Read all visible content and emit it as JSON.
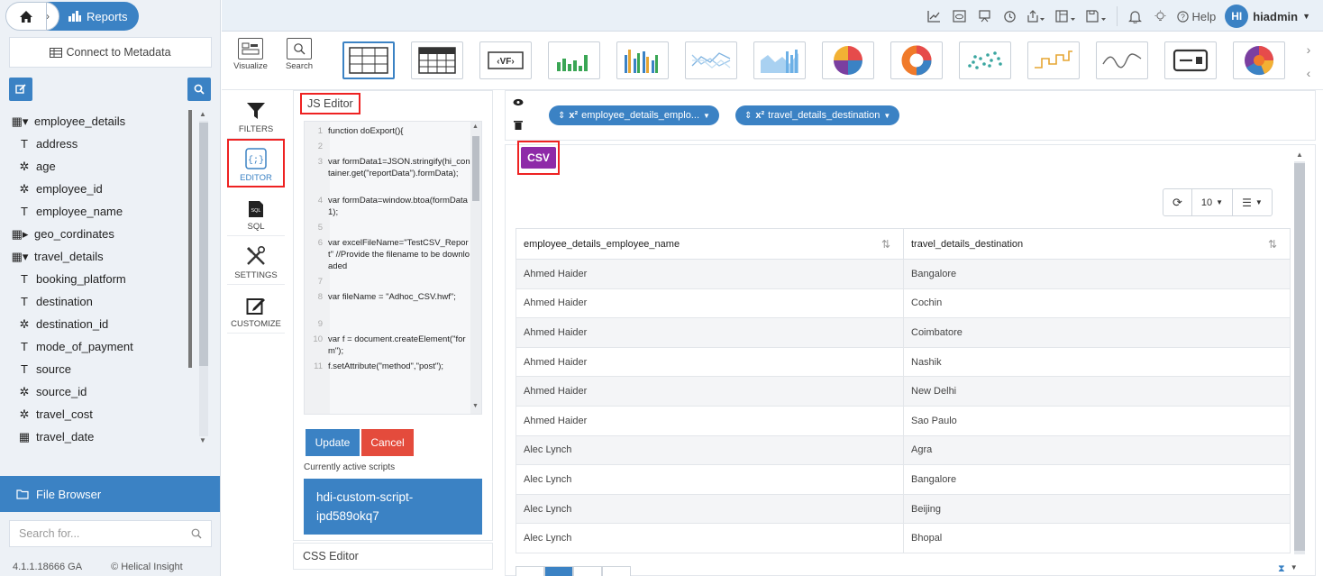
{
  "breadcrumb": {
    "section": "Reports"
  },
  "sidebar": {
    "connect_label": "Connect to Metadata",
    "tree": [
      {
        "icon": "table-icon",
        "glyph": "▦▾",
        "label": "employee_details",
        "level": 0
      },
      {
        "icon": "text-type-icon",
        "glyph": "T",
        "label": "address",
        "level": 1
      },
      {
        "icon": "numeric-type-icon",
        "glyph": "✲",
        "label": "age",
        "level": 1
      },
      {
        "icon": "numeric-type-icon",
        "glyph": "✲",
        "label": "employee_id",
        "level": 1
      },
      {
        "icon": "text-type-icon",
        "glyph": "T",
        "label": "employee_name",
        "level": 1
      },
      {
        "icon": "table-icon",
        "glyph": "▦▸",
        "label": "geo_cordinates",
        "level": 0
      },
      {
        "icon": "table-icon",
        "glyph": "▦▾",
        "label": "travel_details",
        "level": 0
      },
      {
        "icon": "text-type-icon",
        "glyph": "T",
        "label": "booking_platform",
        "level": 1
      },
      {
        "icon": "text-type-icon",
        "glyph": "T",
        "label": "destination",
        "level": 1
      },
      {
        "icon": "numeric-type-icon",
        "glyph": "✲",
        "label": "destination_id",
        "level": 1
      },
      {
        "icon": "text-type-icon",
        "glyph": "T",
        "label": "mode_of_payment",
        "level": 1
      },
      {
        "icon": "text-type-icon",
        "glyph": "T",
        "label": "source",
        "level": 1
      },
      {
        "icon": "numeric-type-icon",
        "glyph": "✲",
        "label": "source_id",
        "level": 1
      },
      {
        "icon": "numeric-type-icon",
        "glyph": "✲",
        "label": "travel_cost",
        "level": 1
      },
      {
        "icon": "date-type-icon",
        "glyph": "▦",
        "label": "travel_date",
        "level": 1
      }
    ],
    "file_browser": "File Browser",
    "search_placeholder": "Search for...",
    "version": "4.1.1.18666 GA",
    "copyright": "© Helical Insight"
  },
  "header": {
    "help_label": "Help",
    "user_initials": "HI",
    "user_name": "hiadmin"
  },
  "viz_toolbar": {
    "visualize_label": "Visualize",
    "search_label": "Search"
  },
  "tools": [
    {
      "name": "filters",
      "label": "FILTERS",
      "icon": "funnel-icon"
    },
    {
      "name": "editor",
      "label": "EDITOR",
      "icon": "code-braces-icon"
    },
    {
      "name": "sql",
      "label": "SQL",
      "icon": "sql-file-icon"
    },
    {
      "name": "settings",
      "label": "SETTINGS",
      "icon": "tools-icon"
    },
    {
      "name": "customize",
      "label": "CUSTOMIZE",
      "icon": "edit-box-icon"
    }
  ],
  "editor": {
    "title": "JS Editor",
    "lines": [
      {
        "n": "1",
        "t": "function doExport(){"
      },
      {
        "n": "2",
        "t": ""
      },
      {
        "n": "3",
        "t": "var formData1=JSON.stringify(hi_container.get(\"reportData\").formData);"
      },
      {
        "n": "4",
        "t": "var formData=window.btoa(formData1);"
      },
      {
        "n": "5",
        "t": ""
      },
      {
        "n": "6",
        "t": "var excelFileName=\"TestCSV_Report\" //Provide the filename to be downloaded"
      },
      {
        "n": "7",
        "t": ""
      },
      {
        "n": "8",
        "t": "var fileName = \"Adhoc_CSV.hwf\";"
      },
      {
        "n": "9",
        "t": ""
      },
      {
        "n": "10",
        "t": "var f = document.createElement(\"form\");"
      },
      {
        "n": "11",
        "t": "f.setAttribute(\"method\",\"post\");"
      }
    ],
    "update_label": "Update",
    "cancel_label": "Cancel",
    "active_scripts_label": "Currently active scripts",
    "active_script": "hdi-custom-script-ipd589okq7",
    "css_editor_label": "CSS Editor"
  },
  "dimensions": [
    {
      "label": "employee_details_emplo..."
    },
    {
      "label": "travel_details_destination"
    }
  ],
  "csv_label": "CSV",
  "table_tools": {
    "page_size": "10"
  },
  "table": {
    "columns": [
      "employee_details_employee_name",
      "travel_details_destination"
    ],
    "rows": [
      [
        "Ahmed Haider",
        "Bangalore"
      ],
      [
        "Ahmed Haider",
        "Cochin"
      ],
      [
        "Ahmed Haider",
        "Coimbatore"
      ],
      [
        "Ahmed Haider",
        "Nashik"
      ],
      [
        "Ahmed Haider",
        "New Delhi"
      ],
      [
        "Ahmed Haider",
        "Sao Paulo"
      ],
      [
        "Alec Lynch",
        "Agra"
      ],
      [
        "Alec Lynch",
        "Bangalore"
      ],
      [
        "Alec Lynch",
        "Beijing"
      ],
      [
        "Alec Lynch",
        "Bhopal"
      ]
    ]
  },
  "colors": {
    "accent": "#3b82c4",
    "csv": "#8e2aa8",
    "cancel": "#e44b3c",
    "highlight": "#e22222"
  }
}
